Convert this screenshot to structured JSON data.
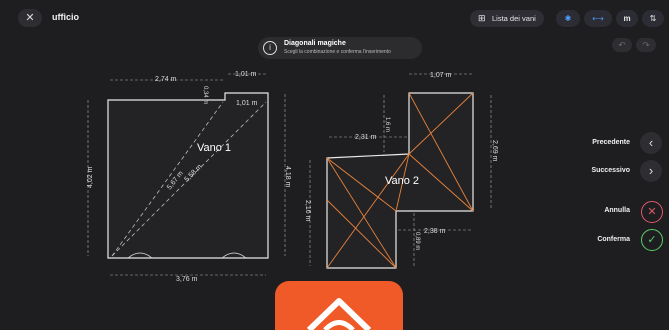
{
  "header": {
    "close_label": "✕",
    "title": "ufficio",
    "list_button_icon": "grid-icon",
    "list_button_label": "Lista dei vani",
    "bluetooth_icon": "bluetooth-icon",
    "measure_icon": "ruler-icon",
    "unit_label": "m",
    "sort_label": "⇅"
  },
  "toast": {
    "icon": "info-icon",
    "title": "Diagonali magiche",
    "subtitle": "Scegli la combinazione e conferma l'inserimento"
  },
  "toolbar": {
    "undo": "↶",
    "redo": "↷"
  },
  "room1": {
    "name": "Vano 1",
    "dims": {
      "top": "2,74 m",
      "notch_w": "1,01 m",
      "notch_h": "0,34 m",
      "notch_inner": "1,01 m",
      "left": "4,02 m",
      "right": "4,18 m",
      "bottom": "3,76 m",
      "diag1": "5,67 m",
      "diag2": "5,58 m"
    }
  },
  "room2": {
    "name": "Vano 2",
    "dims": {
      "top": "1,07 m",
      "step_w": "2,31 m",
      "step_h": "1,6 m",
      "right": "2,69 m",
      "left": "2,16 m",
      "bottom_w": "2,38 m",
      "bottom_h": "0,89 m"
    }
  },
  "sidebar": {
    "prev_label": "Precedente",
    "next_label": "Successivo",
    "cancel_label": "Annulla",
    "confirm_label": "Conferma"
  },
  "colors": {
    "background": "#1e1e20",
    "accent": "#4fa0ff",
    "cancel": "#e05a6a",
    "confirm": "#5ad06a",
    "diagonal_orange": "#e8823a",
    "brand": "#f05a28"
  }
}
